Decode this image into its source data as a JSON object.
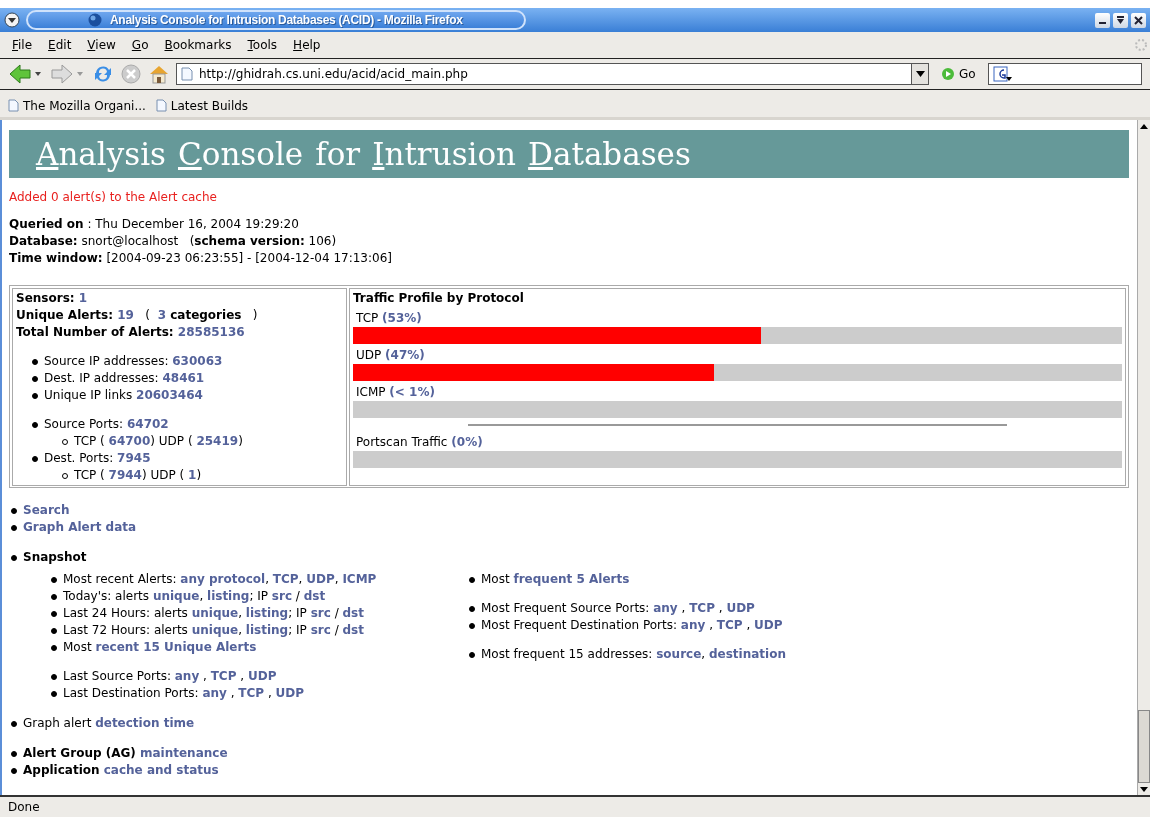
{
  "window": {
    "title": "Analysis Console for Intrusion Databases (ACID) - Mozilla Firefox"
  },
  "menu": [
    {
      "mnemonic": "F",
      "rest": "ile"
    },
    {
      "mnemonic": "E",
      "rest": "dit"
    },
    {
      "mnemonic": "V",
      "rest": "iew"
    },
    {
      "mnemonic": "G",
      "rest": "o"
    },
    {
      "mnemonic": "B",
      "rest": "ookmarks"
    },
    {
      "mnemonic": "T",
      "rest": "ools"
    },
    {
      "mnemonic": "H",
      "rest": "elp"
    }
  ],
  "toolbar": {
    "url": "http://ghidrah.cs.uni.edu/acid/acid_main.php",
    "go": "Go"
  },
  "bookmarks": [
    "The Mozilla Organi...",
    "Latest Builds"
  ],
  "page": {
    "heading": [
      {
        "initial": "A",
        "rest": "nalysis",
        "underlined": true
      },
      {
        "initial": "C",
        "rest": "onsole",
        "underlined": true
      },
      {
        "initial": "f",
        "rest": "or",
        "underlined": false
      },
      {
        "initial": "I",
        "rest": "ntrusion",
        "underlined": true
      },
      {
        "initial": "D",
        "rest": "atabases",
        "underlined": true
      }
    ],
    "notice": "Added 0 alert(s) to the Alert cache",
    "info": [
      [
        {
          "kind": "bold",
          "text": "Queried on"
        },
        {
          "kind": "plain",
          "text": " : Thu December 16, 2004 19:29:20"
        }
      ],
      [
        {
          "kind": "bold",
          "text": "Database:"
        },
        {
          "kind": "plain",
          "text": " snort@localhost   ("
        },
        {
          "kind": "bold",
          "text": "schema version:"
        },
        {
          "kind": "plain",
          "text": " 106)"
        }
      ],
      [
        {
          "kind": "bold",
          "text": "Time window:"
        },
        {
          "kind": "plain",
          "text": " [2004-09-23 06:23:55] - [2004-12-04 17:13:06]"
        }
      ]
    ],
    "stats": {
      "summary": [
        [
          {
            "kind": "bold",
            "text": "Sensors: "
          },
          {
            "kind": "link",
            "text": "1"
          }
        ],
        [
          {
            "kind": "bold",
            "text": "Unique Alerts: "
          },
          {
            "kind": "link",
            "text": "19"
          },
          {
            "kind": "plain",
            "text": "   (  "
          },
          {
            "kind": "link",
            "text": "3"
          },
          {
            "kind": "bold",
            "text": " categories"
          },
          {
            "kind": "plain",
            "text": "   )"
          }
        ],
        [
          {
            "kind": "bold",
            "text": "Total Number of Alerts: "
          },
          {
            "kind": "link",
            "text": "28585136"
          }
        ]
      ],
      "groups": [
        [
          {
            "line": [
              {
                "kind": "plain",
                "text": "Source IP addresses: "
              },
              {
                "kind": "link",
                "text": "630063"
              }
            ]
          },
          {
            "line": [
              {
                "kind": "plain",
                "text": "Dest. IP addresses: "
              },
              {
                "kind": "link",
                "text": "48461"
              }
            ]
          },
          {
            "line": [
              {
                "kind": "plain",
                "text": "Unique IP links "
              },
              {
                "kind": "link",
                "text": "20603464"
              }
            ]
          }
        ],
        [
          {
            "line": [
              {
                "kind": "plain",
                "text": "Source Ports: "
              },
              {
                "kind": "link",
                "text": "64702"
              }
            ],
            "children": [
              {
                "line": [
                  {
                    "kind": "plain",
                    "text": "TCP ( "
                  },
                  {
                    "kind": "link",
                    "text": "64700"
                  },
                  {
                    "kind": "plain",
                    "text": ")  UDP ( "
                  },
                  {
                    "kind": "link",
                    "text": "25419"
                  },
                  {
                    "kind": "plain",
                    "text": ")"
                  }
                ]
              }
            ]
          },
          {
            "line": [
              {
                "kind": "plain",
                "text": "Dest. Ports: "
              },
              {
                "kind": "link",
                "text": "7945"
              }
            ],
            "children": [
              {
                "line": [
                  {
                    "kind": "plain",
                    "text": "TCP ( "
                  },
                  {
                    "kind": "link",
                    "text": "7944"
                  },
                  {
                    "kind": "plain",
                    "text": ")  UDP ( "
                  },
                  {
                    "kind": "link",
                    "text": "1"
                  },
                  {
                    "kind": "plain",
                    "text": ")"
                  }
                ]
              }
            ]
          }
        ]
      ]
    },
    "traffic": {
      "title": "Traffic Profile by Protocol",
      "protocols": [
        {
          "label": "TCP",
          "percent": "(53%)",
          "level": 0.53
        },
        {
          "label": "UDP",
          "percent": "(47%)",
          "level": 0.47
        },
        {
          "label": "ICMP",
          "percent": "(< 1%)",
          "level": 0
        }
      ],
      "portscan": {
        "label": "Portscan Traffic",
        "percent": "(0%)",
        "level": 0
      }
    },
    "nav": [
      [
        {
          "line": [
            {
              "kind": "link",
              "text": "Search"
            }
          ]
        },
        {
          "line": [
            {
              "kind": "link",
              "text": "Graph Alert data"
            }
          ]
        }
      ],
      [
        {
          "line": [
            {
              "kind": "bold",
              "text": "Snapshot"
            }
          ],
          "columns": [
            [
              [
                {
                  "line": [
                    {
                      "kind": "plain",
                      "text": "Most recent Alerts: "
                    },
                    {
                      "kind": "link",
                      "text": "any protocol"
                    },
                    {
                      "kind": "plain",
                      "text": ", "
                    },
                    {
                      "kind": "link",
                      "text": "TCP"
                    },
                    {
                      "kind": "plain",
                      "text": ", "
                    },
                    {
                      "kind": "link",
                      "text": "UDP"
                    },
                    {
                      "kind": "plain",
                      "text": ", "
                    },
                    {
                      "kind": "link",
                      "text": "ICMP"
                    }
                  ]
                },
                {
                  "line": [
                    {
                      "kind": "plain",
                      "text": "Today's: alerts "
                    },
                    {
                      "kind": "link",
                      "text": "unique"
                    },
                    {
                      "kind": "plain",
                      "text": ", "
                    },
                    {
                      "kind": "link",
                      "text": "listing"
                    },
                    {
                      "kind": "plain",
                      "text": "; IP "
                    },
                    {
                      "kind": "link",
                      "text": "src"
                    },
                    {
                      "kind": "plain",
                      "text": " / "
                    },
                    {
                      "kind": "link",
                      "text": "dst"
                    }
                  ]
                },
                {
                  "line": [
                    {
                      "kind": "plain",
                      "text": "Last 24 Hours: alerts "
                    },
                    {
                      "kind": "link",
                      "text": "unique"
                    },
                    {
                      "kind": "plain",
                      "text": ", "
                    },
                    {
                      "kind": "link",
                      "text": "listing"
                    },
                    {
                      "kind": "plain",
                      "text": "; IP "
                    },
                    {
                      "kind": "link",
                      "text": "src"
                    },
                    {
                      "kind": "plain",
                      "text": " / "
                    },
                    {
                      "kind": "link",
                      "text": "dst"
                    }
                  ]
                },
                {
                  "line": [
                    {
                      "kind": "plain",
                      "text": "Last 72 Hours: alerts "
                    },
                    {
                      "kind": "link",
                      "text": "unique"
                    },
                    {
                      "kind": "plain",
                      "text": ", "
                    },
                    {
                      "kind": "link",
                      "text": "listing"
                    },
                    {
                      "kind": "plain",
                      "text": "; IP "
                    },
                    {
                      "kind": "link",
                      "text": "src"
                    },
                    {
                      "kind": "plain",
                      "text": " / "
                    },
                    {
                      "kind": "link",
                      "text": "dst"
                    }
                  ]
                },
                {
                  "line": [
                    {
                      "kind": "plain",
                      "text": "Most "
                    },
                    {
                      "kind": "link",
                      "text": "recent 15 Unique Alerts"
                    }
                  ]
                }
              ],
              [
                {
                  "line": [
                    {
                      "kind": "plain",
                      "text": "Last Source Ports: "
                    },
                    {
                      "kind": "link",
                      "text": "any"
                    },
                    {
                      "kind": "plain",
                      "text": " , "
                    },
                    {
                      "kind": "link",
                      "text": "TCP"
                    },
                    {
                      "kind": "plain",
                      "text": " , "
                    },
                    {
                      "kind": "link",
                      "text": "UDP"
                    }
                  ]
                },
                {
                  "line": [
                    {
                      "kind": "plain",
                      "text": "Last Destination Ports: "
                    },
                    {
                      "kind": "link",
                      "text": "any"
                    },
                    {
                      "kind": "plain",
                      "text": " , "
                    },
                    {
                      "kind": "link",
                      "text": "TCP"
                    },
                    {
                      "kind": "plain",
                      "text": " , "
                    },
                    {
                      "kind": "link",
                      "text": "UDP"
                    }
                  ]
                }
              ]
            ],
            [
              [
                {
                  "line": [
                    {
                      "kind": "plain",
                      "text": "Most "
                    },
                    {
                      "kind": "link",
                      "text": "frequent 5 Alerts"
                    }
                  ]
                }
              ],
              [
                {
                  "line": [
                    {
                      "kind": "plain",
                      "text": "Most Frequent Source Ports: "
                    },
                    {
                      "kind": "link",
                      "text": "any"
                    },
                    {
                      "kind": "plain",
                      "text": " , "
                    },
                    {
                      "kind": "link",
                      "text": "TCP"
                    },
                    {
                      "kind": "plain",
                      "text": " , "
                    },
                    {
                      "kind": "link",
                      "text": "UDP"
                    }
                  ]
                },
                {
                  "line": [
                    {
                      "kind": "plain",
                      "text": "Most Frequent Destination Ports: "
                    },
                    {
                      "kind": "link",
                      "text": "any"
                    },
                    {
                      "kind": "plain",
                      "text": " , "
                    },
                    {
                      "kind": "link",
                      "text": "TCP"
                    },
                    {
                      "kind": "plain",
                      "text": " , "
                    },
                    {
                      "kind": "link",
                      "text": "UDP"
                    }
                  ]
                }
              ],
              [
                {
                  "line": [
                    {
                      "kind": "plain",
                      "text": "Most frequent 15 addresses: "
                    },
                    {
                      "kind": "link",
                      "text": "source"
                    },
                    {
                      "kind": "plain",
                      "text": ", "
                    },
                    {
                      "kind": "link",
                      "text": "destination"
                    }
                  ]
                }
              ]
            ]
          ]
        }
      ],
      [
        {
          "line": [
            {
              "kind": "plain",
              "text": "Graph alert "
            },
            {
              "kind": "link",
              "text": "detection time"
            }
          ]
        }
      ],
      [
        {
          "line": [
            {
              "kind": "bold",
              "text": "Alert Group (AG) "
            },
            {
              "kind": "link",
              "text": "maintenance"
            }
          ]
        },
        {
          "line": [
            {
              "kind": "bold",
              "text": "Application "
            },
            {
              "kind": "link",
              "text": "cache and status"
            }
          ]
        }
      ]
    ]
  },
  "status_bar": "Done"
}
